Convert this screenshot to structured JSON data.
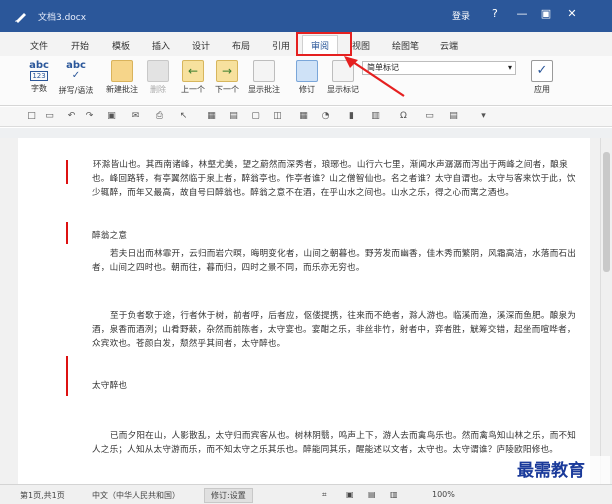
{
  "window": {
    "title": "文档3.docx",
    "login": "登录",
    "help": "?",
    "minimize": "—",
    "restore": "▣",
    "close": "✕"
  },
  "tabs": [
    "文件",
    "开始",
    "模板",
    "插入",
    "设计",
    "布局",
    "引用",
    "审阅",
    "视图",
    "绘图笔",
    "云端"
  ],
  "active_tab": "审阅",
  "ribbon": {
    "word_count": "字数",
    "spelling": "拼写/语法",
    "new_comment": "新建批注",
    "delete": "删除",
    "previous": "上一个",
    "next": "下一个",
    "show_comments": "显示批注",
    "track_changes": "修订",
    "show_markup": "显示标记",
    "markup_option": "简单标记",
    "accept": "应用",
    "abc": "abc",
    "abc_num": "123"
  },
  "document": {
    "paragraphs": [
      "环滁皆山也。其西南诸峰，林壑尤美，望之蔚然而深秀者，琅琊也。山行六七里，渐闻水声潺潺而泻出于两峰之间者，酿泉也。峰回路转，有亭翼然临于泉上者，醉翁亭也。作亭者谁？山之僧智仙也。名之者谁？太守自谓也。太守与客来饮于此，饮少辄醉，而年又最高，故自号曰醉翁也。醉翁之意不在酒，在乎山水之间也。山水之乐，得之心而寓之酒也。",
      "醉翁之意",
      "若夫日出而林霏开，云归而岩穴暝，晦明变化者，山间之朝暮也。野芳发而幽香，佳木秀而繁阴，风霜高洁，水落而石出者，山间之四时也。朝而往，暮而归，四时之景不同，而乐亦无穷也。",
      "至于负者歌于途，行者休于树，前者呼，后者应，伛偻提携，往来而不绝者，滁人游也。临溪而渔，溪深而鱼肥。酿泉为酒，泉香而酒洌；山肴野蔌，杂然而前陈者，太守宴也。宴酣之乐，非丝非竹，射者中，弈者胜，觥筹交错，起坐而喧哗者，众宾欢也。苍颜白发，颓然乎其间者，太守醉也。",
      "太守醉也",
      "已而夕阳在山，人影散乱，太守归而宾客从也。树林阴翳，鸣声上下，游人去而禽鸟乐也。然而禽鸟知山林之乐，而不知人之乐；人知从太守游而乐，而不知太守之乐其乐也。醉能同其乐，醒能述以文者，太守也。太守谓谁？庐陵欧阳修也。"
    ]
  },
  "status": {
    "page": "第1页,共1页",
    "language": "中文（中华人民共和国）",
    "track_mode": "修订:设置",
    "zoom": "100%"
  },
  "watermark": "最需教育",
  "colors": {
    "titlebar": "#2b579a",
    "highlight": "#e52020",
    "change_bar": "#dd1111"
  }
}
